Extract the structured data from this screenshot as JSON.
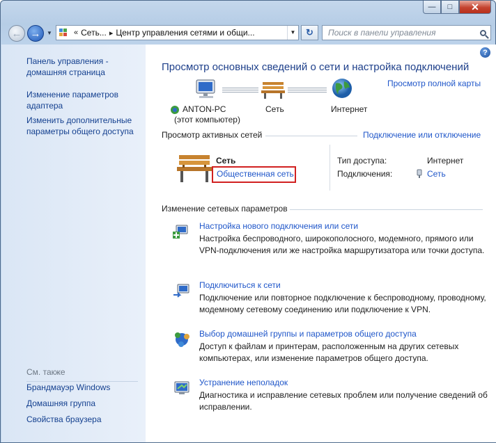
{
  "window": {
    "caption": {
      "minimize": "—",
      "maximize": "□",
      "close": "✕"
    }
  },
  "nav": {
    "back_glyph": "←",
    "forward_glyph": "→",
    "address": {
      "chevrons": "«",
      "segments": [
        "Сеть...",
        "Центр управления сетями и общи..."
      ],
      "separator": "▸"
    },
    "refresh_glyph": "↻",
    "search_placeholder": "Поиск в панели управления"
  },
  "sidebar": {
    "home_link": "Панель управления - домашняя страница",
    "links": [
      "Изменение параметров адаптера",
      "Изменить дополнительные параметры общего доступа"
    ],
    "see_also": {
      "title": "См. также",
      "links": [
        "Брандмауэр Windows",
        "Домашняя группа",
        "Свойства браузера"
      ]
    }
  },
  "main": {
    "help": "?",
    "title": "Просмотр основных сведений о сети и настройка подключений",
    "full_map_link": "Просмотр полной карты",
    "map": {
      "computer": "ANTON-PC",
      "computer_sub": "(этот компьютер)",
      "network": "Сеть",
      "internet": "Интернет"
    },
    "active_networks": {
      "title": "Просмотр активных сетей",
      "connect_link": "Подключение или отключение",
      "network_name": "Сеть",
      "network_type": "Общественная сеть",
      "access_type_label": "Тип доступа:",
      "access_type_value": "Интернет",
      "connections_label": "Подключения:",
      "connections_value": "Сеть"
    },
    "change_settings": {
      "title": "Изменение сетевых параметров",
      "tasks": [
        {
          "link": "Настройка нового подключения или сети",
          "desc": "Настройка беспроводного, широкополосного, модемного, прямого или VPN-подключения или же настройка маршрутизатора или точки доступа."
        },
        {
          "link": "Подключиться к сети",
          "desc": "Подключение или повторное подключение к беспроводному, проводному, модемному сетевому соединению или подключение к VPN."
        },
        {
          "link": "Выбор домашней группы и параметров общего доступа",
          "desc": "Доступ к файлам и принтерам, расположенным на других сетевых компьютерах, или изменение параметров общего доступа."
        },
        {
          "link": "Устранение неполадок",
          "desc": "Диагностика и исправление сетевых проблем или получение сведений об исправлении."
        }
      ]
    }
  }
}
